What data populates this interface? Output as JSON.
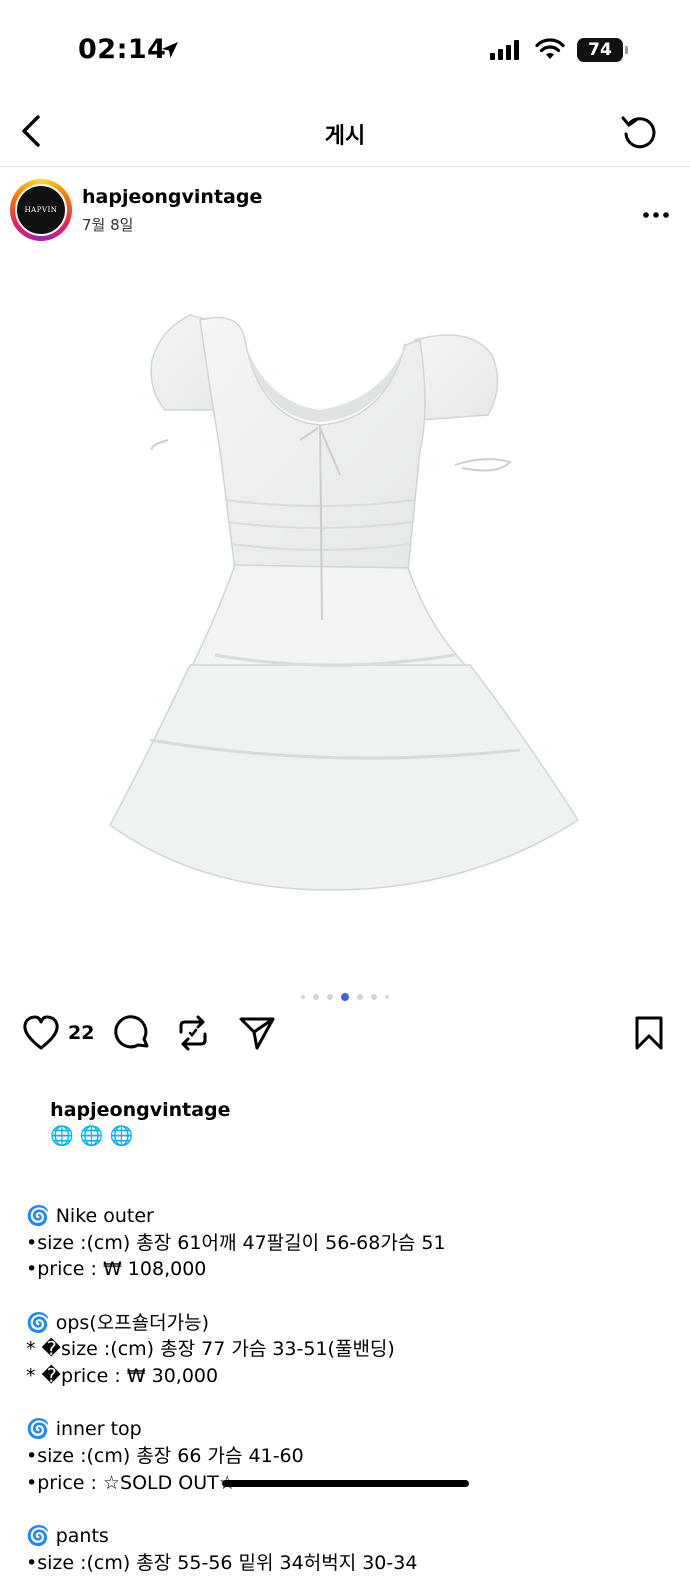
{
  "status_bar": {
    "time": "02:14",
    "battery": "74"
  },
  "header": {
    "title": "게시"
  },
  "post": {
    "username": "hapjeongvintage",
    "date": "7월 8일",
    "avatar_text": "HAPVIN",
    "likes": "22",
    "carousel": {
      "count": 7,
      "active_index": 3
    }
  },
  "caption": {
    "username": "hapjeongvintage",
    "username_emoji": "🌐 🌐 🌐",
    "lines": [
      "🌀 Nike outer",
      "•size :(cm) 총장 61어깨 47팔길이 56-68가슴 51",
      "•price : ₩ 108,000",
      "",
      "🌀 ops(오프숄더가능)",
      "* �size :(cm) 총장 77 가슴 33-51(풀밴딩)",
      "* �price : ₩ 30,000",
      "",
      "🌀 inner top",
      "•size :(cm) 총장 66 가슴 41-60",
      "•price : ☆SOLD OUT☆",
      "",
      "🌀 pants",
      "•size :(cm) 총장 55-56 밑위 34허벅지 30-34"
    ]
  },
  "colors": {
    "accent_dot": "#3d62e6"
  }
}
